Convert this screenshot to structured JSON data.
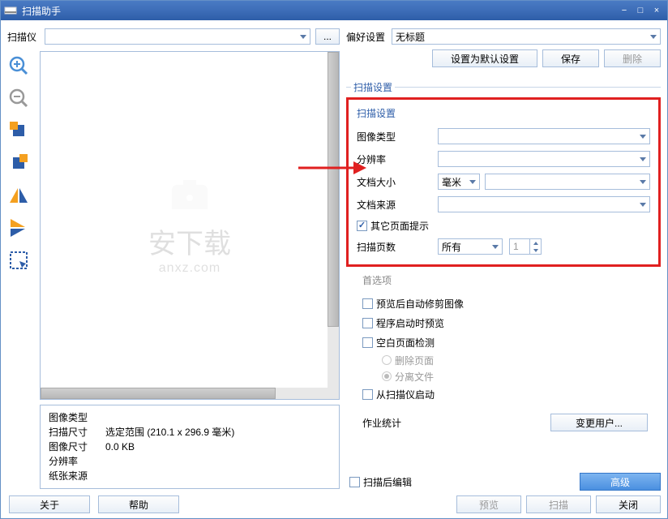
{
  "window": {
    "title": "扫描助手"
  },
  "left": {
    "scanner_label": "扫描仪",
    "scanner_value": "",
    "scanner_btn": "...",
    "info": {
      "image_type_label": "图像类型",
      "image_type_value": "",
      "scan_size_label": "扫描尺寸",
      "scan_size_value": "选定范围 (210.1 x 296.9 毫米)",
      "image_size_label": "图像尺寸",
      "image_size_value": "0.0 KB",
      "resolution_label": "分辨率",
      "resolution_value": "",
      "paper_source_label": "纸张来源",
      "paper_source_value": ""
    },
    "about_btn": "关于",
    "help_btn": "帮助"
  },
  "right": {
    "pref_label": "偏好设置",
    "pref_value": "无标题",
    "set_default_btn": "设置为默认设置",
    "save_btn": "保存",
    "delete_btn": "删除",
    "scan_settings_title": "扫描设置",
    "scan_settings_sub": "扫描设置",
    "image_type_label": "图像类型",
    "resolution_label": "分辨率",
    "doc_size_label": "文档大小",
    "doc_size_unit": "毫米",
    "doc_source_label": "文档来源",
    "other_page_prompt_label": "其它页面提示",
    "scan_pages_label": "扫描页数",
    "scan_pages_mode": "所有",
    "scan_pages_value": "1",
    "options_title": "首选项",
    "opt_trim_label": "预览后自动修剪图像",
    "opt_preview_start_label": "程序启动时预览",
    "opt_blank_detect_label": "空白页面检测",
    "opt_delete_page": "删除页面",
    "opt_split_file": "分离文件",
    "opt_start_scanner_label": "从扫描仪启动",
    "stats_label": "作业统计",
    "change_user_btn": "变更用户...",
    "scan_after_edit": "扫描后编辑",
    "advanced_btn": "高级",
    "preview_btn": "预览",
    "scan_btn": "扫描",
    "close_btn": "关闭"
  }
}
